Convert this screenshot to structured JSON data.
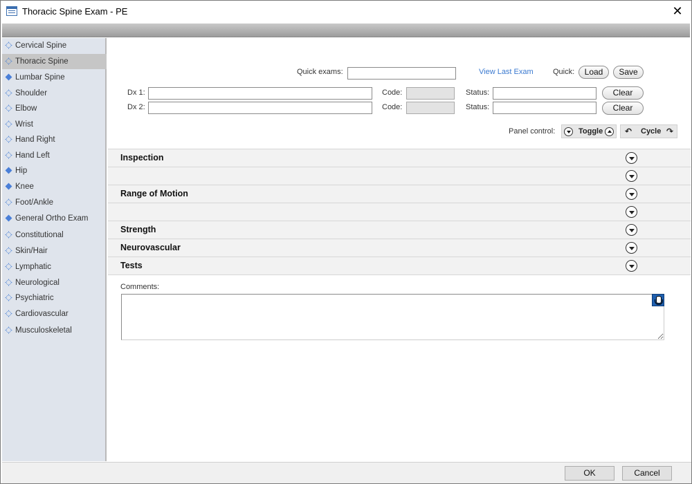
{
  "window": {
    "title": "Thoracic Spine Exam - PE",
    "close_glyph": "✕"
  },
  "sidebar": {
    "items": [
      {
        "label": "Cervical Spine",
        "bullet": "hollow",
        "selected": false
      },
      {
        "label": "Thoracic Spine",
        "bullet": "hollow",
        "selected": true
      },
      {
        "label": "Lumbar Spine",
        "bullet": "filled",
        "selected": false
      },
      {
        "label": "Shoulder",
        "bullet": "hollow",
        "selected": false
      },
      {
        "label": "Elbow",
        "bullet": "hollow",
        "selected": false
      },
      {
        "label": "Wrist",
        "bullet": "hollow",
        "selected": false
      },
      {
        "label": "Hand Right",
        "bullet": "hollow",
        "selected": false
      },
      {
        "label": "Hand Left",
        "bullet": "hollow",
        "selected": false
      },
      {
        "label": "Hip",
        "bullet": "filled",
        "selected": false
      },
      {
        "label": "Knee",
        "bullet": "filled",
        "selected": false
      },
      {
        "label": "Foot/Ankle",
        "bullet": "hollow",
        "selected": false
      },
      {
        "label": "General Ortho Exam",
        "bullet": "filled",
        "selected": false
      },
      {
        "label": "Constitutional",
        "bullet": "hollow",
        "selected": false
      },
      {
        "label": "Skin/Hair",
        "bullet": "hollow",
        "selected": false
      },
      {
        "label": "Lymphatic",
        "bullet": "hollow",
        "selected": false
      },
      {
        "label": "Neurological",
        "bullet": "hollow",
        "selected": false
      },
      {
        "label": "Psychiatric",
        "bullet": "hollow",
        "selected": false
      },
      {
        "label": "Cardiovascular",
        "bullet": "hollow",
        "selected": false
      },
      {
        "label": "Musculoskeletal",
        "bullet": "hollow",
        "selected": false
      }
    ]
  },
  "toolbar": {
    "quick_exams_label": "Quick exams:",
    "quick_exams_value": "",
    "view_last_exam": "View Last Exam",
    "quick_label": "Quick:",
    "load_label": "Load",
    "save_label": "Save"
  },
  "diagnoses": {
    "dx1_label": "Dx 1:",
    "dx1_value": "",
    "dx2_label": "Dx 2:",
    "dx2_value": "",
    "code_label": "Code:",
    "status_label": "Status:",
    "clear_label": "Clear"
  },
  "panel_control": {
    "label": "Panel control:",
    "toggle_label": "Toggle",
    "cycle_label": "Cycle"
  },
  "sections": [
    {
      "title": "Inspection"
    },
    {
      "title": ""
    },
    {
      "title": "Range of Motion"
    },
    {
      "title": ""
    },
    {
      "title": "Strength"
    },
    {
      "title": "Neurovascular"
    },
    {
      "title": "Tests"
    }
  ],
  "comments": {
    "label": "Comments:",
    "value": ""
  },
  "footer": {
    "ok_label": "OK",
    "cancel_label": "Cancel"
  },
  "colors": {
    "sidebar_bg": "#dfe4ec",
    "link": "#3b7ad0",
    "bullet": "#4a7fd8",
    "selected": "#c6c6c6"
  }
}
